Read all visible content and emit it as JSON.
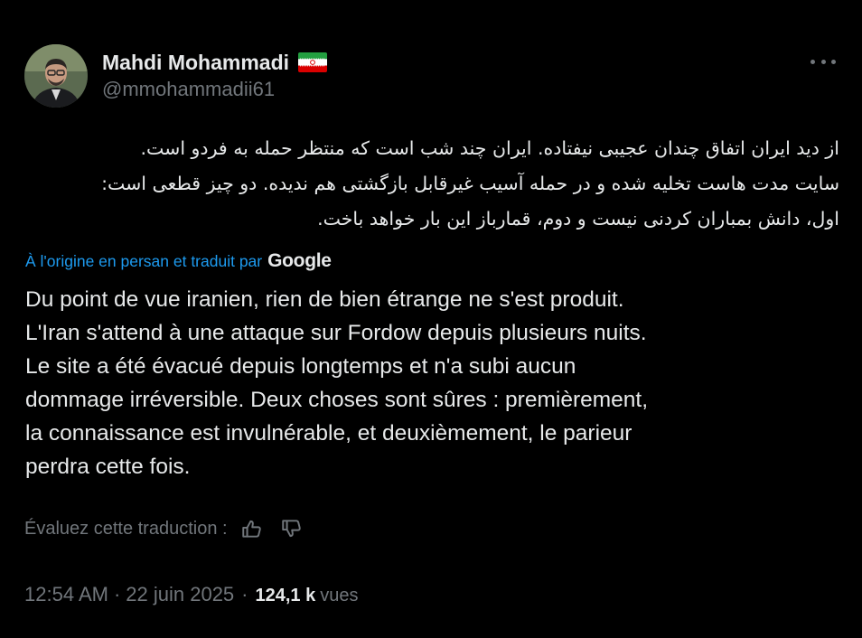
{
  "author": {
    "name": "Mahdi Mohammadi",
    "handle": "@mmohammadii61",
    "flag_icon": "iran-flag-icon"
  },
  "tweet": {
    "original_lines": [
      "از دید ایران اتفاق چندان عجیبی نیفتاده. ایران چند شب است که منتظر حمله به فردو است.",
      "سایت مدت هاست تخلیه شده و در حمله آسیب غیرقابل بازگشتی هم ندیده. دو چیز قطعی است:",
      "اول، دانش بمباران کردنی نیست و دوم، قمارباز این بار خواهد باخت."
    ],
    "translated_by": "À l'origine en persan et traduit par",
    "translator": "Google",
    "translation_lines": [
      "Du point de vue iranien, rien de bien étrange ne s'est produit.",
      "L'Iran s'attend à une attaque sur Fordow depuis plusieurs nuits.",
      "Le site a été évacué depuis longtemps et n'a subi aucun",
      "dommage irréversible. Deux choses sont sûres : premièrement,",
      "la connaissance est invulnérable, et deuxièmement, le parieur",
      "perdra cette fois."
    ],
    "rate_label": "Évaluez cette traduction :",
    "time": "12:54 AM",
    "separator": "·",
    "date": "22 juin 2025",
    "views_count": "124,1 k",
    "views_label": "vues"
  },
  "icons": {
    "more": "more-options-icon",
    "thumbs_up": "thumbs-up-icon",
    "thumbs_down": "thumbs-down-icon"
  },
  "colors": {
    "background": "#000000",
    "text": "#e7e9ea",
    "secondary": "#71767b",
    "link": "#1d9bf0"
  }
}
